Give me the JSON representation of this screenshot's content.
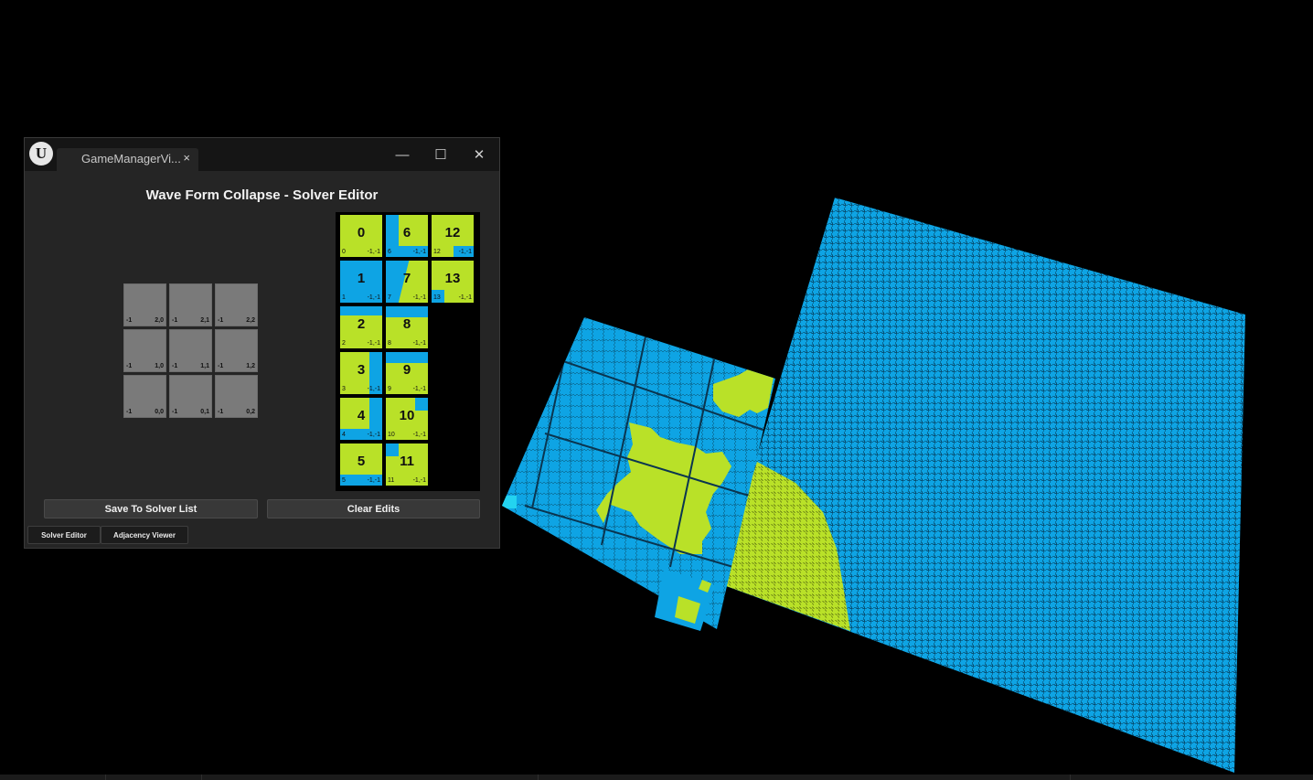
{
  "window": {
    "tab_title": "GameManagerVi...",
    "close_tab_glyph": "×",
    "minimize_glyph": "—",
    "maximize_glyph": "☐",
    "close_glyph": "✕",
    "logo_glyph": "U",
    "heading": "Wave Form Collapse - Solver Editor"
  },
  "preview_grid": [
    [
      {
        "left": "-1",
        "right": "2,0"
      },
      {
        "left": "-1",
        "right": "2,1"
      },
      {
        "left": "-1",
        "right": "2,2"
      }
    ],
    [
      {
        "left": "-1",
        "right": "1,0"
      },
      {
        "left": "-1",
        "right": "1,1"
      },
      {
        "left": "-1",
        "right": "1,2"
      }
    ],
    [
      {
        "left": "-1",
        "right": "0,0"
      },
      {
        "left": "-1",
        "right": "0,1"
      },
      {
        "left": "-1",
        "right": "0,2"
      }
    ]
  ],
  "tiles": [
    {
      "num": "0",
      "left": "0",
      "right": "-1,-1",
      "pattern": "solid-green"
    },
    {
      "num": "6",
      "left": "6",
      "right": "-1,-1",
      "pattern": "blue-left-bottom"
    },
    {
      "num": "12",
      "left": "12",
      "right": "-1,-1",
      "pattern": "blue-bottom-right"
    },
    {
      "num": "1",
      "left": "1",
      "right": "-1,-1",
      "pattern": "solid-blue"
    },
    {
      "num": "7",
      "left": "7",
      "right": "-1,-1",
      "pattern": "diagonal-blue-green"
    },
    {
      "num": "13",
      "left": "13",
      "right": "-1,-1",
      "pattern": "blue-corner-bottom-left"
    },
    {
      "num": "2",
      "left": "2",
      "right": "-1,-1",
      "pattern": "blue-top"
    },
    {
      "num": "8",
      "left": "8",
      "right": "-1,-1",
      "pattern": "blue-top-band"
    },
    {
      "num": "3",
      "left": "3",
      "right": "-1,-1",
      "pattern": "blue-right"
    },
    {
      "num": "9",
      "left": "9",
      "right": "-1,-1",
      "pattern": "blue-top-band"
    },
    {
      "num": "4",
      "left": "4",
      "right": "-1,-1",
      "pattern": "blue-bottom-right-strip"
    },
    {
      "num": "10",
      "left": "10",
      "right": "-1,-1",
      "pattern": "blue-top-right-corner"
    },
    {
      "num": "5",
      "left": "5",
      "right": "-1,-1",
      "pattern": "blue-bottom"
    },
    {
      "num": "11",
      "left": "11",
      "right": "-1,-1",
      "pattern": "blue-top-left-corner"
    }
  ],
  "buttons": {
    "save": "Save To Solver List",
    "clear": "Clear Edits"
  },
  "tabs": {
    "solver_editor": "Solver Editor",
    "adjacency_viewer": "Adjacency Viewer"
  },
  "colors": {
    "blue": "#0ea4e4",
    "green": "#b9e128",
    "cyan": "#23d3f0",
    "background": "#000000",
    "panel": "#252525"
  }
}
